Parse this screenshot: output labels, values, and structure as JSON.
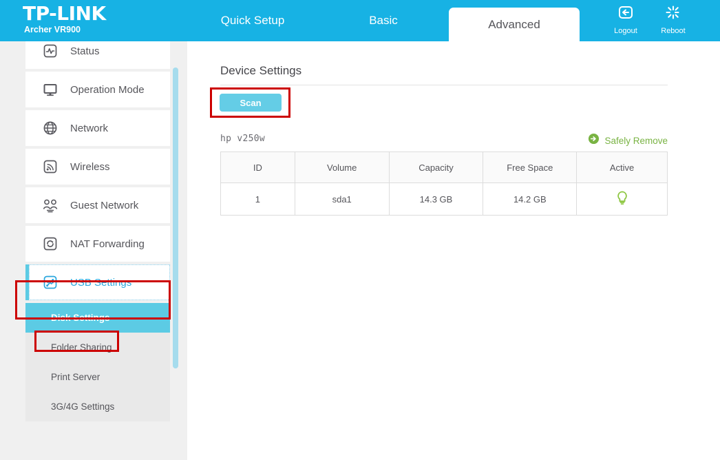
{
  "header": {
    "brand": "TP-LINK",
    "model": "Archer VR900",
    "tabs": [
      {
        "label": "Quick Setup",
        "active": false
      },
      {
        "label": "Basic",
        "active": false
      },
      {
        "label": "Advanced",
        "active": true
      }
    ],
    "actions": [
      {
        "label": "Logout",
        "icon": "logout-icon"
      },
      {
        "label": "Reboot",
        "icon": "reboot-icon"
      }
    ],
    "bg_color": "#17b2e4"
  },
  "sidebar": {
    "items": [
      {
        "label": "Status",
        "icon": "status-pulse-icon",
        "active": false
      },
      {
        "label": "Operation Mode",
        "icon": "monitor-icon",
        "active": false
      },
      {
        "label": "Network",
        "icon": "globe-icon",
        "active": false
      },
      {
        "label": "Wireless",
        "icon": "wifi-icon",
        "active": false
      },
      {
        "label": "Guest Network",
        "icon": "guest-users-icon",
        "active": false
      },
      {
        "label": "NAT Forwarding",
        "icon": "nat-refresh-icon",
        "active": false
      },
      {
        "label": "USB Settings",
        "icon": "usb-icon",
        "active": true
      }
    ],
    "submenu": [
      {
        "label": "Disk Settings",
        "active": true
      },
      {
        "label": "Folder Sharing",
        "active": false
      },
      {
        "label": "Print Server",
        "active": false
      },
      {
        "label": "3G/4G Settings",
        "active": false
      }
    ],
    "active_color": "#5ccbe4"
  },
  "main": {
    "title": "Device Settings",
    "scan_button": "Scan",
    "device_name": "hp  v250w",
    "safely_remove": "Safely Remove",
    "safely_remove_color": "#79b343",
    "table": {
      "columns": [
        "ID",
        "Volume",
        "Capacity",
        "Free Space",
        "Active"
      ],
      "rows": [
        {
          "id": "1",
          "volume": "sda1",
          "capacity": "14.3 GB",
          "free_space": "14.2 GB",
          "active_icon": "bulb-on-icon"
        }
      ]
    }
  },
  "annotations": {
    "color": "#cc0000",
    "boxes": [
      "scan-button",
      "usb-settings-menu-item",
      "disk-settings-submenu-item"
    ]
  }
}
